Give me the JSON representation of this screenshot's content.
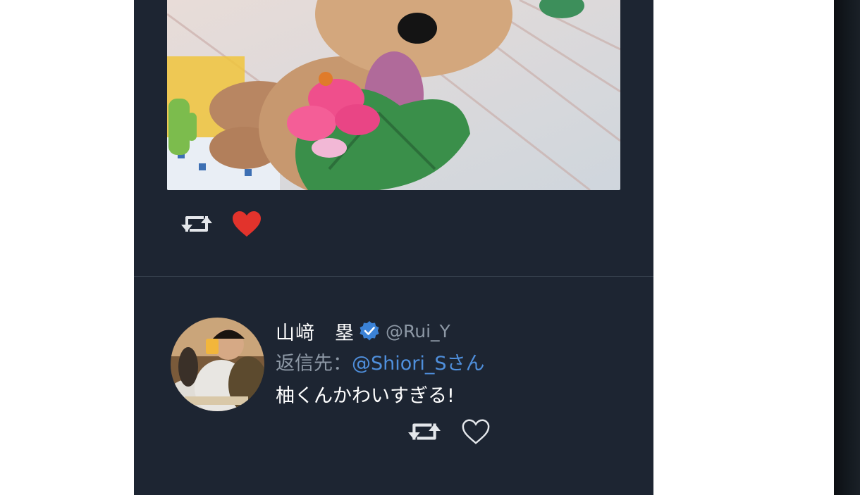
{
  "media": {
    "alt_icon": "photo-dog-with-flower-lei"
  },
  "tweet1": {
    "retweet_icon": "retweet-icon",
    "like_icon": "heart-filled-icon",
    "liked": true,
    "like_color": "#e2332c"
  },
  "reply": {
    "display_name": "山﨑　塁",
    "verified": true,
    "handle": "@Rui_Y",
    "reply_prefix": "返信先：",
    "reply_mention": "@Shiori_Sさん",
    "text": "柚くんかわいすぎる!",
    "retweet_icon": "retweet-icon",
    "like_icon": "heart-outline-icon",
    "liked": false
  },
  "colors": {
    "panel_bg": "#1d2532",
    "mention": "#4f8fdc",
    "muted": "#8d98a5",
    "verified": "#3b82d6"
  }
}
